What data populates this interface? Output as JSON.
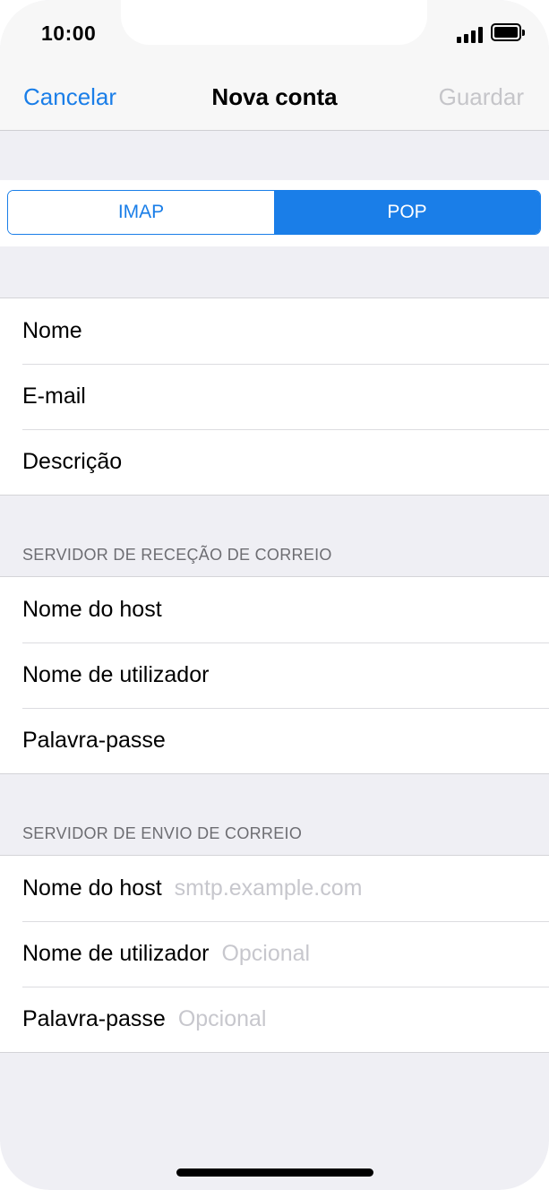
{
  "status_bar": {
    "time": "10:00",
    "signal_icon": "cellular-signal-icon",
    "battery_icon": "battery-icon"
  },
  "nav": {
    "cancel": "Cancelar",
    "title": "Nova conta",
    "save": "Guardar"
  },
  "account_type": {
    "options": [
      "IMAP",
      "POP"
    ],
    "selected": "POP"
  },
  "account_info": {
    "rows": [
      {
        "label": "Nome"
      },
      {
        "label": "E-mail"
      },
      {
        "label": "Descrição"
      }
    ]
  },
  "incoming": {
    "header": "SERVIDOR DE RECEÇÃO DE CORREIO",
    "rows": [
      {
        "label": "Nome do host"
      },
      {
        "label": "Nome de utilizador"
      },
      {
        "label": "Palavra-passe"
      }
    ]
  },
  "outgoing": {
    "header": "SERVIDOR DE ENVIO DE CORREIO",
    "rows": [
      {
        "label": "Nome do host",
        "placeholder": "smtp.example.com"
      },
      {
        "label": "Nome de utilizador",
        "placeholder": "Opcional"
      },
      {
        "label": "Palavra-passe",
        "placeholder": "Opcional"
      }
    ]
  },
  "colors": {
    "accent": "#1a7ee8",
    "disabled": "#c5c5c9",
    "grouped_background": "#efeff4",
    "placeholder": "#c7c7cd"
  }
}
